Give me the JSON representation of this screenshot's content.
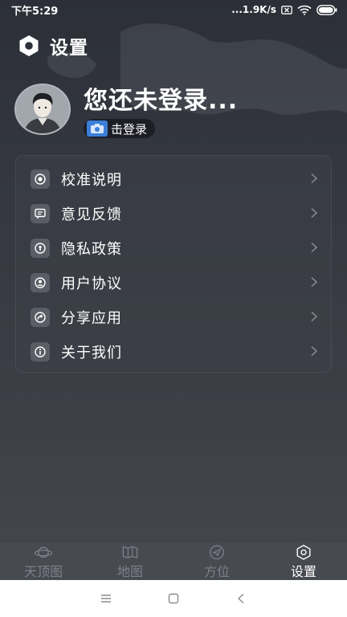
{
  "status_bar": {
    "time": "下午5:29",
    "network_speed": "...1.9K/s",
    "icons": [
      "sim-off-icon",
      "wifi-icon",
      "battery-icon"
    ]
  },
  "header": {
    "icon": "hexagon-gear-icon",
    "title": "设置"
  },
  "profile": {
    "avatar": "avatar-portrait",
    "name": "您还未登录...",
    "login_button": "击登录",
    "login_icon": "camera-sticker-icon"
  },
  "menu": {
    "items": [
      {
        "icon": "eye-target-icon",
        "label": "校准说明"
      },
      {
        "icon": "message-icon",
        "label": "意见反馈"
      },
      {
        "icon": "lock-shield-icon",
        "label": "隐私政策"
      },
      {
        "icon": "user-icon",
        "label": "用户协议"
      },
      {
        "icon": "share-icon",
        "label": "分享应用"
      },
      {
        "icon": "info-icon",
        "label": "关于我们"
      }
    ]
  },
  "bottom_nav": {
    "tabs": [
      {
        "icon": "planet-icon",
        "label": "天顶图",
        "active": false
      },
      {
        "icon": "map-icon",
        "label": "地图",
        "active": false
      },
      {
        "icon": "compass-arrow-icon",
        "label": "方位",
        "active": false
      },
      {
        "icon": "hexagon-settings-icon",
        "label": "设置",
        "active": true
      }
    ]
  },
  "system_nav": [
    "menu-icon",
    "home-square-icon",
    "back-icon"
  ],
  "colors": {
    "background_top": "#2c2f37",
    "background_bottom": "#45474e",
    "nav_bar": "#484a51",
    "inactive_label": "#7d8088",
    "active_label": "#ffffff",
    "login_badge": "#3b7fd9"
  }
}
